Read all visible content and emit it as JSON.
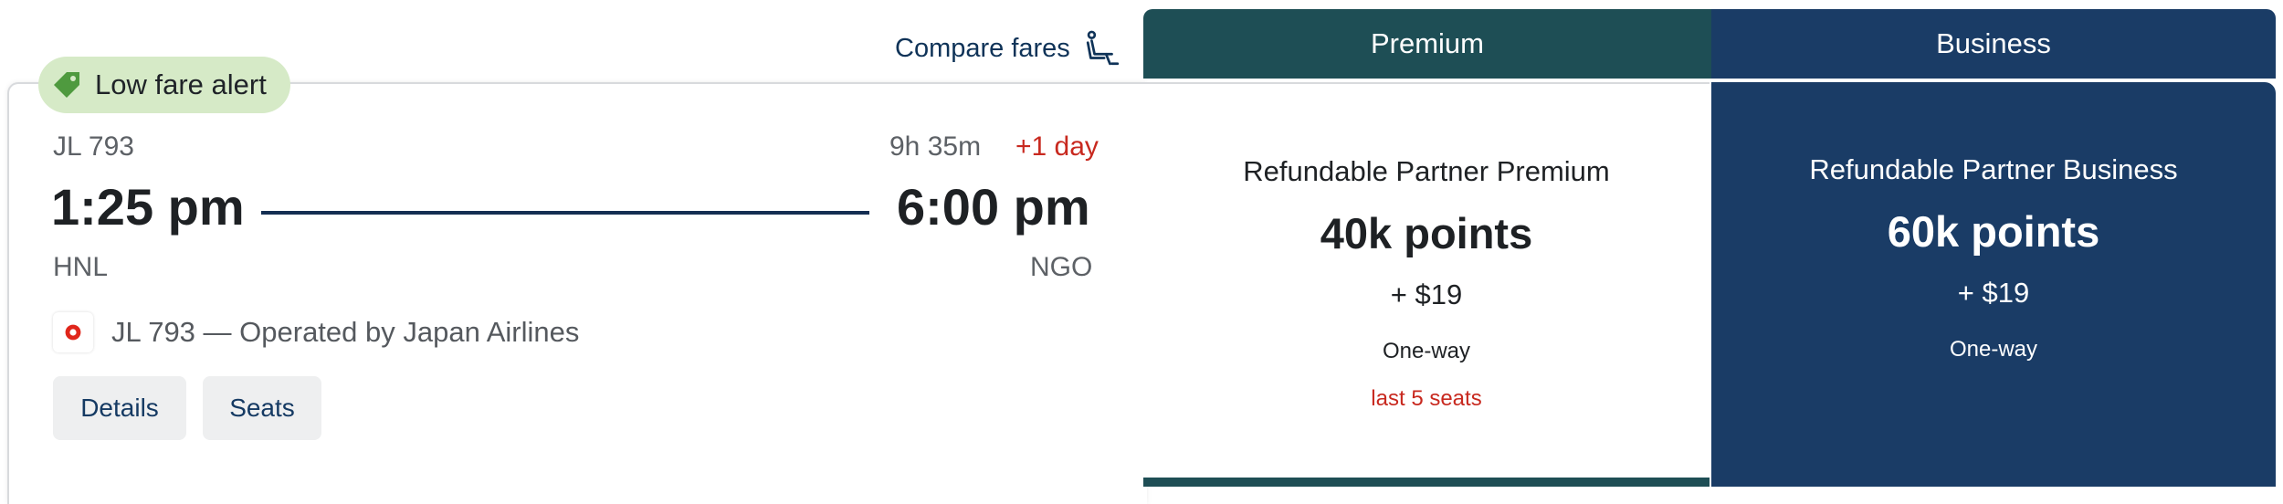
{
  "compare": {
    "label": "Compare fares",
    "icon": "seat-icon"
  },
  "tabs": [
    {
      "label": "Premium"
    },
    {
      "label": "Business"
    }
  ],
  "alert": {
    "label": "Low fare alert",
    "icon": "tag-icon",
    "color": "#d6eac7"
  },
  "flight": {
    "number": "JL 793",
    "duration": "9h 35m",
    "day_offset": "+1 day",
    "depart_time": "1:25 pm",
    "arrive_time": "6:00 pm",
    "origin": "HNL",
    "destination": "NGO",
    "operated_by": "JL 793 — Operated by Japan Airlines",
    "airline_logo": "japan-airlines-logo"
  },
  "actions": {
    "details": "Details",
    "seats": "Seats"
  },
  "fares": {
    "premium": {
      "name": "Refundable Partner Premium",
      "points": "40k points",
      "fee": "+ $19",
      "trip": "One-way",
      "seats_left": "last 5 seats",
      "color": "#1e4e55"
    },
    "business": {
      "name": "Refundable Partner Business",
      "points": "60k points",
      "fee": "+ $19",
      "trip": "One-way",
      "color": "#1a3c66"
    }
  }
}
